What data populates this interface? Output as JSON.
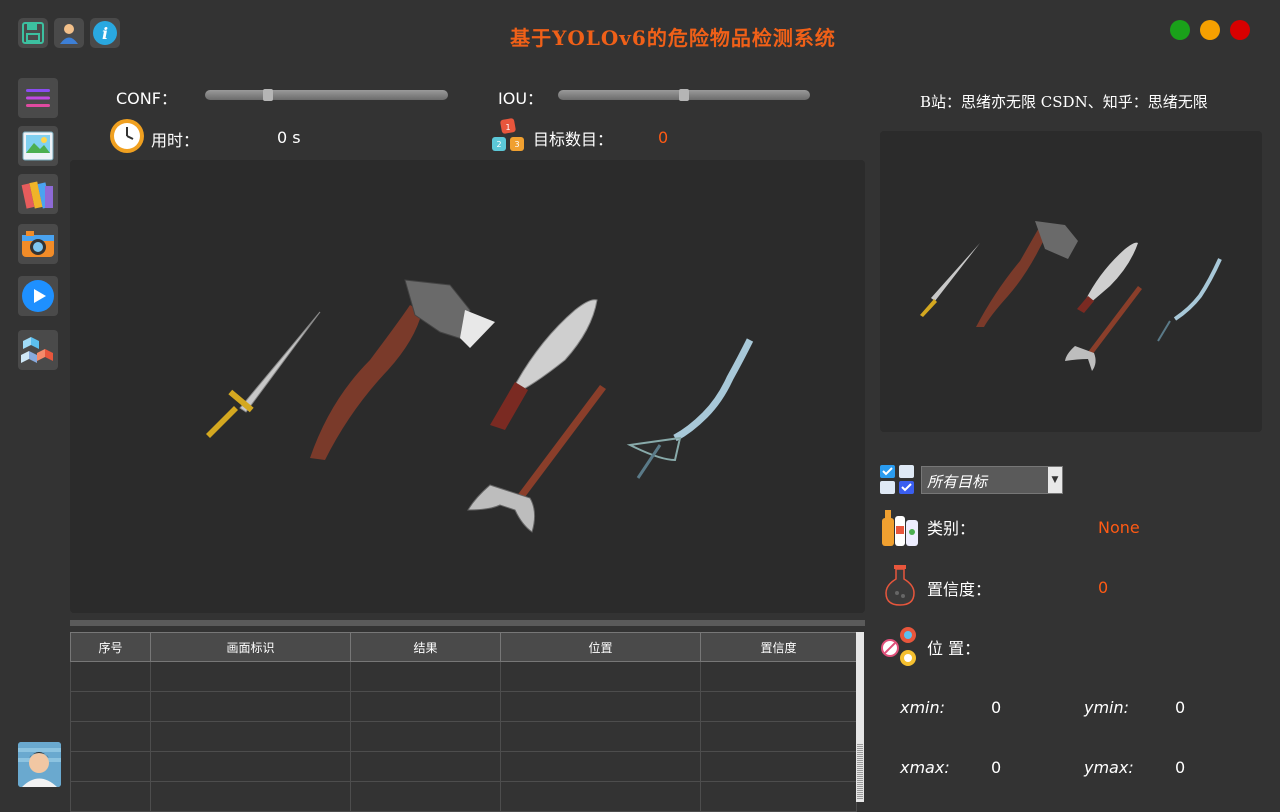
{
  "app": {
    "title": "基于YOLOv6的危险物品检测系统",
    "accent_color": "#f06018",
    "window_controls": [
      {
        "name": "minimize",
        "color": "#1aa11a"
      },
      {
        "name": "maximize",
        "color": "#f5a000"
      },
      {
        "name": "close",
        "color": "#d80000"
      }
    ]
  },
  "toolbar_icons": [
    "save-icon",
    "user-icon",
    "info-icon"
  ],
  "sidebar_icons": [
    "menu-icon",
    "image-icon",
    "folder-icon",
    "camera-icon",
    "video-play-icon",
    "model-cube-icon"
  ],
  "controls": {
    "conf_label": "CONF：",
    "conf_value": 0.25,
    "iou_label": "IOU：",
    "iou_value": 0.5,
    "time_label": "用时：",
    "time_value": "0 s",
    "count_label": "目标数目：",
    "count_value": "0"
  },
  "credit": "B站：思绪亦无限  CSDN、知乎：思绪无限",
  "target_select": {
    "selected": "所有目标"
  },
  "details": {
    "class_label": "类别：",
    "class_value": "None",
    "confidence_label": "置信度：",
    "confidence_value": "0",
    "position_label": "位 置：",
    "xmin_label": "xmin:",
    "xmin_value": "0",
    "ymin_label": "ymin:",
    "ymin_value": "0",
    "xmax_label": "xmax:",
    "xmax_value": "0",
    "ymax_label": "ymax:",
    "ymax_value": "0"
  },
  "table": {
    "headers": [
      "序号",
      "画面标识",
      "结果",
      "位置",
      "置信度"
    ],
    "rows": [
      [
        "",
        "",
        "",
        "",
        ""
      ],
      [
        "",
        "",
        "",
        "",
        ""
      ],
      [
        "",
        "",
        "",
        "",
        ""
      ],
      [
        "",
        "",
        "",
        "",
        ""
      ],
      [
        "",
        "",
        "",
        "",
        ""
      ]
    ]
  }
}
